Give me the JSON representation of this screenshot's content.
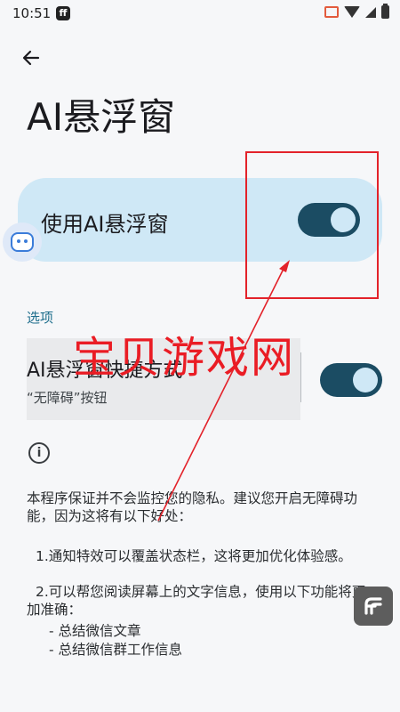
{
  "status_bar": {
    "time": "10:51"
  },
  "header": {
    "title": "AI悬浮窗"
  },
  "main_card": {
    "label": "使用AI悬浮窗",
    "enabled": true
  },
  "section": {
    "label": "选项"
  },
  "option": {
    "title": "AI悬浮窗快捷方式",
    "subtitle": "“无障碍”按钮",
    "enabled": true
  },
  "info": {
    "description": "本程序保证并不会监控您的隐私。建议您开启无障碍功能，因为这将有以下好处：",
    "benefit_1": "1.通知特效可以覆盖状态栏，这将更加优化体验感。",
    "benefit_2": "2.可以帮您阅读屏幕上的文字信息，使用以下功能将更加准确：",
    "bullets": [
      "- 总结微信文章",
      "- 总结微信群工作信息"
    ]
  },
  "overlay": {
    "watermark": "宝贝游戏网"
  },
  "colors": {
    "accent": "#1b4c63",
    "card_bg": "#cfe8f6",
    "annotation": "#e3222a"
  }
}
